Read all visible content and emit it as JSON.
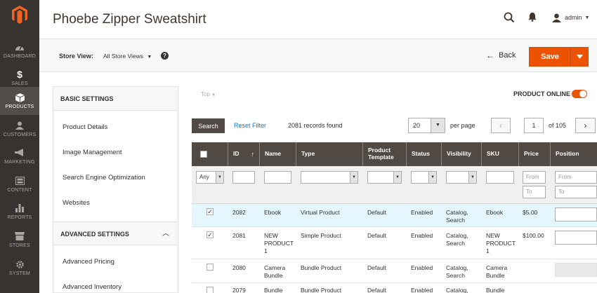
{
  "sidebar": {
    "logo": "magento-logo",
    "items": [
      {
        "label": "DASHBOARD",
        "icon": "dashboard-icon"
      },
      {
        "label": "SALES",
        "icon": "dollar-icon"
      },
      {
        "label": "PRODUCTS",
        "icon": "box-icon",
        "active": true
      },
      {
        "label": "CUSTOMERS",
        "icon": "person-icon"
      },
      {
        "label": "MARKETING",
        "icon": "megaphone-icon"
      },
      {
        "label": "CONTENT",
        "icon": "layout-icon"
      },
      {
        "label": "REPORTS",
        "icon": "bar-chart-icon"
      },
      {
        "label": "STORES",
        "icon": "storefront-icon"
      },
      {
        "label": "SYSTEM",
        "icon": "gear-icon"
      }
    ]
  },
  "header": {
    "title": "Phoebe Zipper Sweatshirt",
    "user": "admin"
  },
  "store_bar": {
    "label": "Store View:",
    "value": "All Store Views",
    "help": "?",
    "back_label": "Back",
    "save_label": "Save"
  },
  "settings": {
    "basic_heading": "BASIC SETTINGS",
    "basic_items": [
      "Product Details",
      "Image Management",
      "Search Engine Optimization",
      "Websites"
    ],
    "advanced_heading": "ADVANCED SETTINGS",
    "advanced_items": [
      "Advanced Pricing",
      "Advanced Inventory"
    ]
  },
  "grid": {
    "breadcrumb": "Top",
    "online_label": "PRODUCT ONLINE",
    "search_label": "Search",
    "reset_label": "Reset Filter",
    "records": "2081 records found",
    "per_page_value": "20",
    "per_page_label": "per page",
    "page": "1",
    "of_pages": "of 105",
    "columns": [
      "ID",
      "Name",
      "Type",
      "Product Template",
      "Status",
      "Visibility",
      "SKU",
      "Price",
      "Position"
    ],
    "filters": {
      "any": "Any",
      "from_placeholder": "From",
      "to_placeholder": "To"
    },
    "rows": [
      {
        "checked": true,
        "id": "2082",
        "name": "Ebook",
        "type": "Virtual Product",
        "template": "Default",
        "status": "Enabled",
        "visibility": "Catalog, Search",
        "sku": "Ebook",
        "price": "$5.00",
        "pos_enabled": true
      },
      {
        "checked": true,
        "id": "2081",
        "name": "NEW PRODUCT 1",
        "type": "Simple Product",
        "template": "Default",
        "status": "Enabled",
        "visibility": "Catalog, Search",
        "sku": "NEW PRODUCT 1",
        "price": "$100.00",
        "pos_enabled": true
      },
      {
        "checked": false,
        "id": "2080",
        "name": "Camera Bundle",
        "type": "Bundle Product",
        "template": "Default",
        "status": "Enabled",
        "visibility": "Catalog, Search",
        "sku": "Camera Bundle",
        "price": "",
        "pos_enabled": false
      },
      {
        "checked": false,
        "id": "2079",
        "name": "Bundle",
        "type": "Bundle Product",
        "template": "Default",
        "status": "Enabled",
        "visibility": "Catalog,",
        "sku": "Bundle",
        "price": "",
        "pos_enabled": false
      }
    ]
  },
  "colors": {
    "sidebar": "#373330",
    "accent": "#eb5202",
    "table_header": "#514943",
    "link": "#007bdb"
  }
}
